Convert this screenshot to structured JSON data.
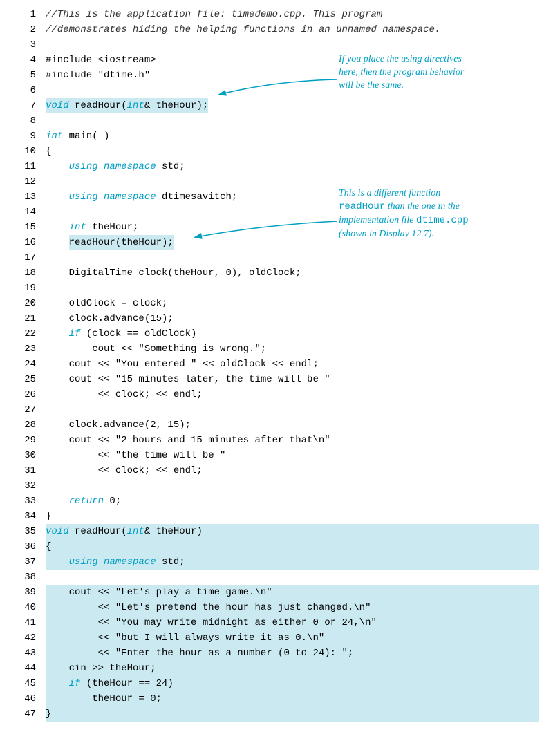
{
  "annotations": {
    "a1": {
      "l1": "If you place the using directives",
      "l2": "here, then the program behavior",
      "l3": "will be the same."
    },
    "a2": {
      "l1": "This is a different function",
      "l2_mono": "readHour",
      "l2_rest": " than the one in the",
      "l3_a": "implementation file ",
      "l3_mono": "dtime.cpp",
      "l4": "(shown in Display 12.7)."
    }
  },
  "lines": [
    {
      "n": 1,
      "parts": [
        {
          "cls": "cmt",
          "t": "//This is the application file: timedemo.cpp. This program"
        }
      ]
    },
    {
      "n": 2,
      "parts": [
        {
          "cls": "cmt",
          "t": "//demonstrates hiding the helping functions in an unnamed namespace."
        }
      ]
    },
    {
      "n": 3,
      "parts": [
        {
          "t": ""
        }
      ]
    },
    {
      "n": 4,
      "parts": [
        {
          "t": "#include <iostream>"
        }
      ]
    },
    {
      "n": 5,
      "parts": [
        {
          "t": "#include \"dtime.h\""
        }
      ]
    },
    {
      "n": 6,
      "parts": [
        {
          "t": ""
        }
      ]
    },
    {
      "n": 7,
      "hl": true,
      "parts": [
        {
          "cls": "kw",
          "t": "void"
        },
        {
          "t": " readHour("
        },
        {
          "cls": "kw",
          "t": "int"
        },
        {
          "t": "& theHour);"
        }
      ]
    },
    {
      "n": 8,
      "parts": [
        {
          "t": ""
        }
      ]
    },
    {
      "n": 9,
      "parts": [
        {
          "cls": "kw",
          "t": "int"
        },
        {
          "t": " main( )"
        }
      ]
    },
    {
      "n": 10,
      "parts": [
        {
          "t": "{"
        }
      ]
    },
    {
      "n": 11,
      "parts": [
        {
          "t": "    "
        },
        {
          "cls": "kw",
          "t": "using namespace"
        },
        {
          "t": " std;"
        }
      ]
    },
    {
      "n": 12,
      "parts": [
        {
          "t": ""
        }
      ]
    },
    {
      "n": 13,
      "parts": [
        {
          "t": "    "
        },
        {
          "cls": "kw",
          "t": "using namespace"
        },
        {
          "t": " dtimesavitch;"
        }
      ]
    },
    {
      "n": 14,
      "parts": [
        {
          "t": ""
        }
      ]
    },
    {
      "n": 15,
      "parts": [
        {
          "t": "    "
        },
        {
          "cls": "kw",
          "t": "int"
        },
        {
          "t": " theHour;"
        }
      ]
    },
    {
      "n": 16,
      "parts": [
        {
          "t": "    "
        },
        {
          "hl": true,
          "t": "readHour(theHour);"
        }
      ]
    },
    {
      "n": 17,
      "parts": [
        {
          "t": ""
        }
      ]
    },
    {
      "n": 18,
      "parts": [
        {
          "t": "    DigitalTime clock(theHour, 0), oldClock;"
        }
      ]
    },
    {
      "n": 19,
      "parts": [
        {
          "t": ""
        }
      ]
    },
    {
      "n": 20,
      "parts": [
        {
          "t": "    oldClock = clock;"
        }
      ]
    },
    {
      "n": 21,
      "parts": [
        {
          "t": "    clock.advance(15);"
        }
      ]
    },
    {
      "n": 22,
      "parts": [
        {
          "t": "    "
        },
        {
          "cls": "kw",
          "t": "if"
        },
        {
          "t": " (clock == oldClock)"
        }
      ]
    },
    {
      "n": 23,
      "parts": [
        {
          "t": "        cout << \"Something is wrong.\";"
        }
      ]
    },
    {
      "n": 24,
      "parts": [
        {
          "t": "    cout << \"You entered \" << oldClock << endl;"
        }
      ]
    },
    {
      "n": 25,
      "parts": [
        {
          "t": "    cout << \"15 minutes later, the time will be \""
        }
      ]
    },
    {
      "n": 26,
      "parts": [
        {
          "t": "         << clock; << endl;"
        }
      ]
    },
    {
      "n": 27,
      "parts": [
        {
          "t": ""
        }
      ]
    },
    {
      "n": 28,
      "parts": [
        {
          "t": "    clock.advance(2, 15);"
        }
      ]
    },
    {
      "n": 29,
      "parts": [
        {
          "t": "    cout << \"2 hours and 15 minutes after that\\n\""
        }
      ]
    },
    {
      "n": 30,
      "parts": [
        {
          "t": "         << \"the time will be \""
        }
      ]
    },
    {
      "n": 31,
      "parts": [
        {
          "t": "         << clock; << endl;"
        }
      ]
    },
    {
      "n": 32,
      "parts": [
        {
          "t": ""
        }
      ]
    },
    {
      "n": 33,
      "parts": [
        {
          "t": "    "
        },
        {
          "cls": "kw",
          "t": "return"
        },
        {
          "t": " 0;"
        }
      ]
    },
    {
      "n": 34,
      "parts": [
        {
          "t": "}"
        }
      ]
    },
    {
      "n": 35,
      "block": true,
      "parts": [
        {
          "cls": "kw",
          "t": "void"
        },
        {
          "t": " readHour("
        },
        {
          "cls": "kw",
          "t": "int"
        },
        {
          "t": "& theHour)"
        }
      ]
    },
    {
      "n": 36,
      "block": true,
      "parts": [
        {
          "t": "{"
        }
      ]
    },
    {
      "n": 37,
      "block": true,
      "parts": [
        {
          "t": "    "
        },
        {
          "cls": "kw",
          "t": "using namespace"
        },
        {
          "t": " std;"
        }
      ]
    },
    {
      "n": 38,
      "block": true,
      "parts": [
        {
          "t": ""
        }
      ]
    },
    {
      "n": 39,
      "block": true,
      "parts": [
        {
          "t": "    cout << \"Let's play a time game.\\n\""
        }
      ]
    },
    {
      "n": 40,
      "block": true,
      "parts": [
        {
          "t": "         << \"Let's pretend the hour has just changed.\\n\""
        }
      ]
    },
    {
      "n": 41,
      "block": true,
      "parts": [
        {
          "t": "         << \"You may write midnight as either 0 or 24,\\n\""
        }
      ]
    },
    {
      "n": 42,
      "block": true,
      "parts": [
        {
          "t": "         << \"but I will always write it as 0.\\n\""
        }
      ]
    },
    {
      "n": 43,
      "block": true,
      "parts": [
        {
          "t": "         << \"Enter the hour as a number (0 to 24): \";"
        }
      ]
    },
    {
      "n": 44,
      "block": true,
      "parts": [
        {
          "t": "    cin >> theHour;"
        }
      ]
    },
    {
      "n": 45,
      "block": true,
      "parts": [
        {
          "t": "    "
        },
        {
          "cls": "kw",
          "t": "if"
        },
        {
          "t": " (theHour == 24)"
        }
      ]
    },
    {
      "n": 46,
      "block": true,
      "parts": [
        {
          "t": "        theHour = 0;"
        }
      ]
    },
    {
      "n": 47,
      "block": true,
      "parts": [
        {
          "t": "}"
        }
      ]
    }
  ]
}
